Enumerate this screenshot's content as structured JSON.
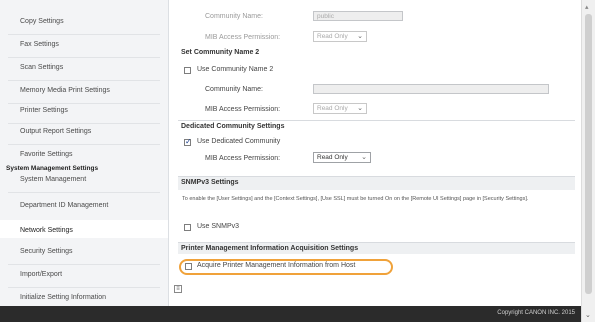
{
  "sidebar": {
    "items": [
      {
        "label": "Copy Settings"
      },
      {
        "label": "Fax Settings"
      },
      {
        "label": "Scan Settings"
      },
      {
        "label": "Memory Media Print Settings"
      },
      {
        "label": "Printer Settings"
      },
      {
        "label": "Output Report Settings"
      },
      {
        "label": "Favorite Settings"
      }
    ],
    "group_heading": "System Management Settings",
    "group_items": [
      {
        "label": "System Management"
      },
      {
        "label": "Department ID Management"
      },
      {
        "label": "Network Settings"
      },
      {
        "label": "Security Settings"
      },
      {
        "label": "Import/Export"
      },
      {
        "label": "Initialize Setting Information"
      }
    ]
  },
  "main": {
    "community1": {
      "name_label": "Community Name:",
      "name_value": "public",
      "mib_label": "MIB Access Permission:",
      "mib_value": "Read Only"
    },
    "community2": {
      "heading": "Set Community Name 2",
      "checkbox_label": "Use Community Name 2",
      "name_label": "Community Name:",
      "name_value": "",
      "mib_label": "MIB Access Permission:",
      "mib_value": "Read Only"
    },
    "dedicated": {
      "heading": "Dedicated Community Settings",
      "checkbox_label": "Use Dedicated Community",
      "mib_label": "MIB Access Permission:",
      "mib_value": "Read Only"
    },
    "snmpv3": {
      "heading": "SNMPv3 Settings",
      "note": "To enable the [User Settings] and the [Context Settings], [Use SSL] must be turned On on the [Remote UI Settings] page in [Security Settings].",
      "checkbox_label": "Use SNMPv3"
    },
    "printer_mgmt": {
      "heading": "Printer Management Information Acquisition Settings",
      "checkbox_label": "Acquire Printer Management Information from Host"
    }
  },
  "footer": {
    "copyright": "Copyright CANON INC. 2015"
  }
}
